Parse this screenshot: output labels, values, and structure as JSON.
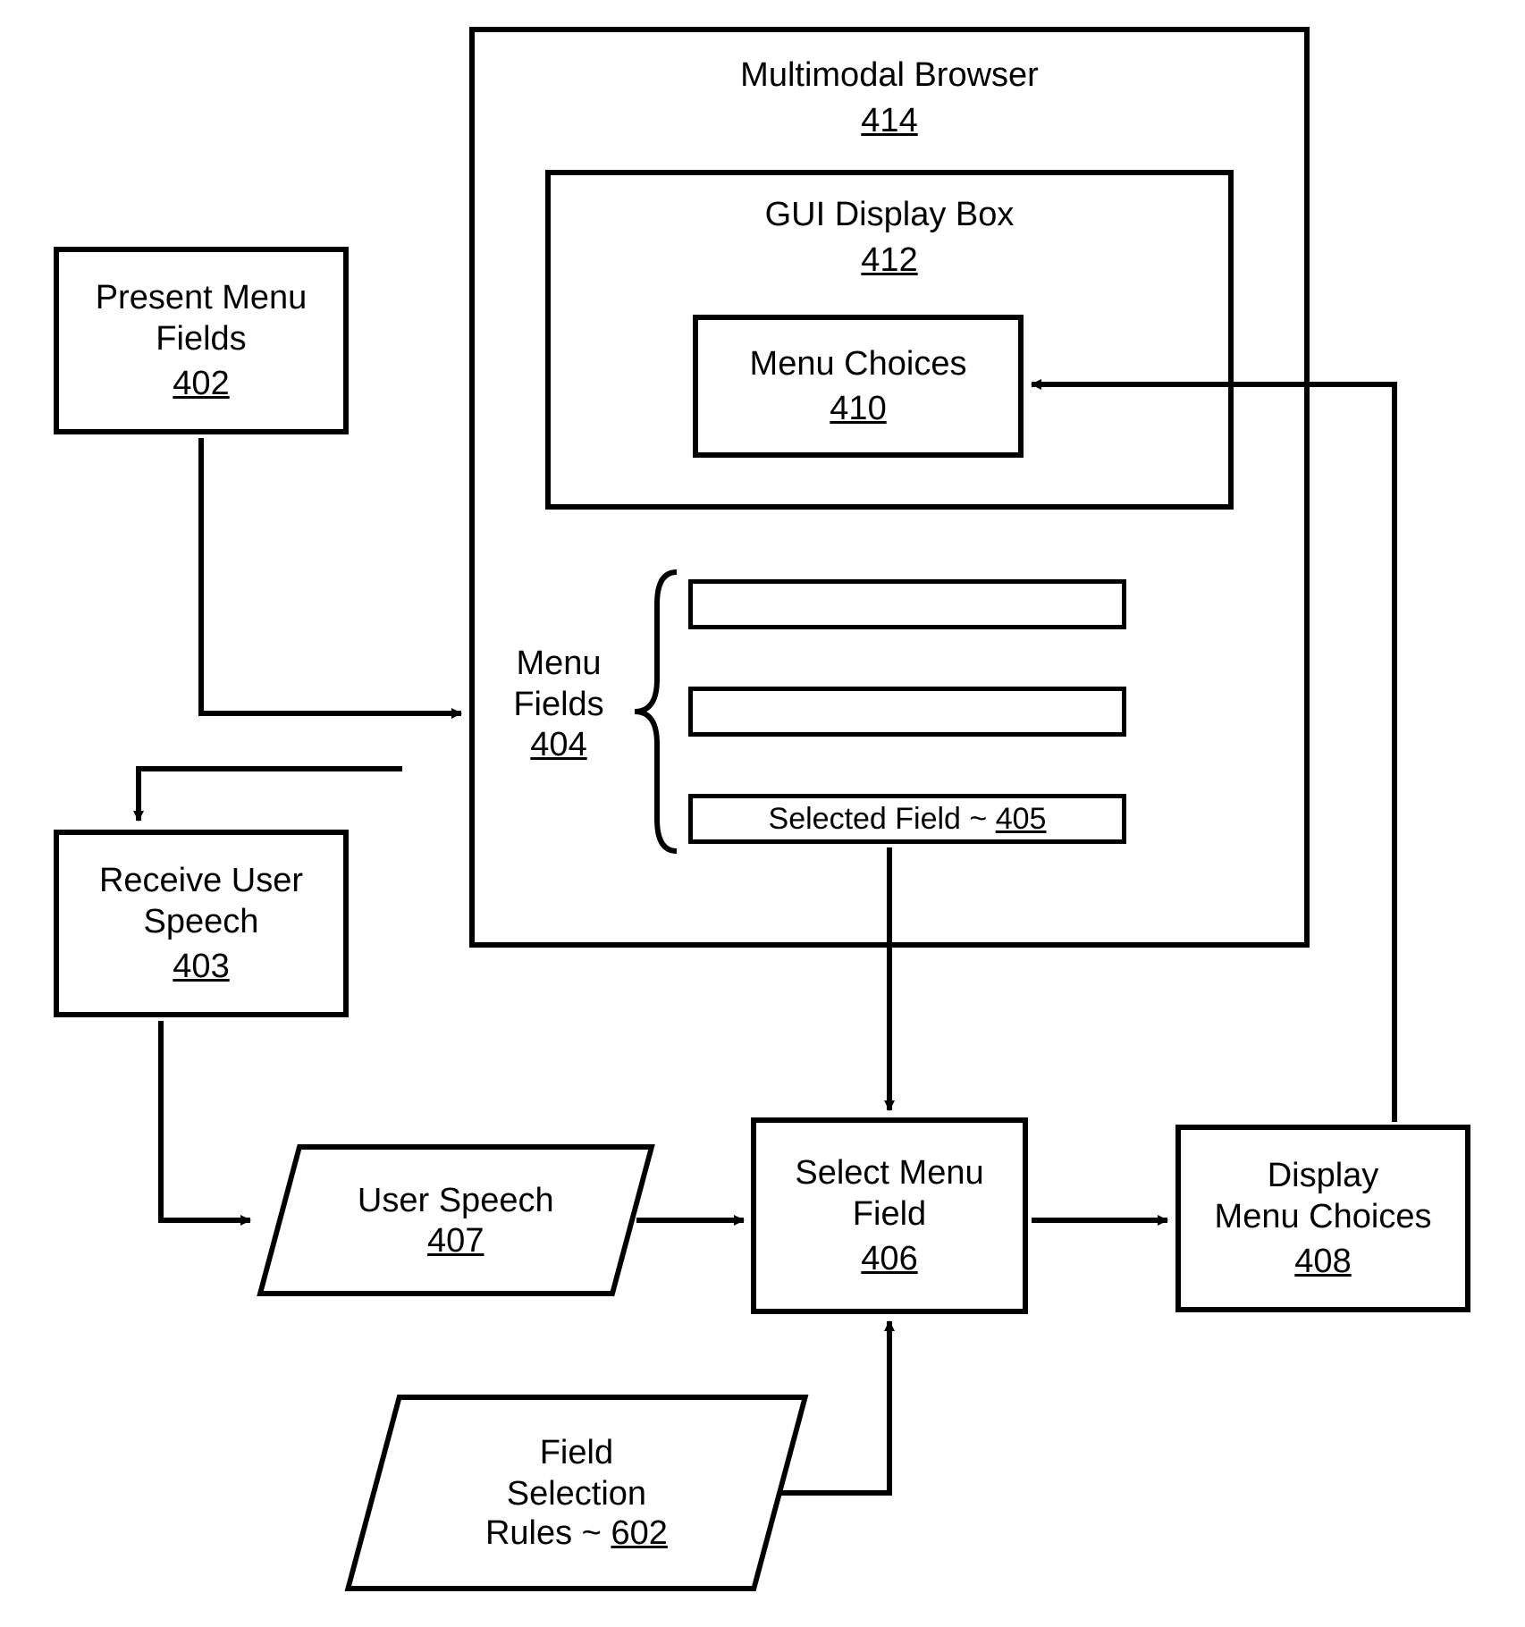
{
  "browser": {
    "title": "Multimodal Browser",
    "ref": "414"
  },
  "gui": {
    "title": "GUI Display Box",
    "ref": "412"
  },
  "menuChoices": {
    "title": "Menu Choices",
    "ref": "410"
  },
  "menuFieldsLabel": {
    "title": "Menu\nFields",
    "ref": "404"
  },
  "selectedField": {
    "title": "Selected Field",
    "ref": "405"
  },
  "presentMenu": {
    "title": "Present Menu\nFields",
    "ref": "402"
  },
  "receiveSpeech": {
    "title": "Receive User\nSpeech",
    "ref": "403"
  },
  "userSpeech": {
    "title": "User Speech",
    "ref": "407"
  },
  "selectMenu": {
    "title": "Select Menu\nField",
    "ref": "406"
  },
  "displayChoices": {
    "title": "Display\nMenu Choices",
    "ref": "408"
  },
  "fieldRules": {
    "title": "Field\nSelection\nRules",
    "ref": "602"
  }
}
